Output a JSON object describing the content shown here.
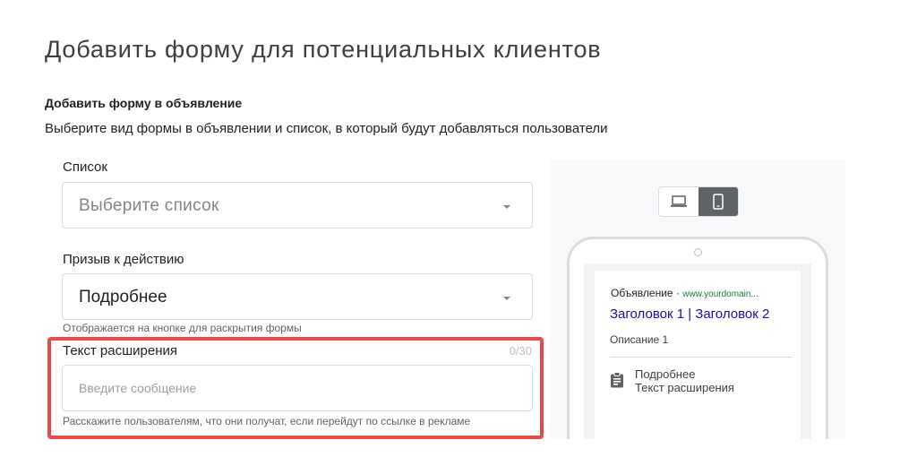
{
  "page": {
    "title": "Добавить форму для потенциальных клиентов"
  },
  "section": {
    "title": "Добавить форму в объявление",
    "description": "Выберите вид формы в объявлении и список, в который будут добавляться пользователи"
  },
  "list_field": {
    "label": "Список",
    "placeholder": "Выберите список"
  },
  "cta_field": {
    "label": "Призыв к действию",
    "value": "Подробнее",
    "helper": "Отображается на кнопке для раскрытия формы"
  },
  "extension_field": {
    "label": "Текст расширения",
    "counter": "0/30",
    "placeholder": "Введите сообщение",
    "helper": "Расскажите пользователям, что они получат, если перейдут по ссылке в рекламе"
  },
  "highlight": {
    "color": "#e94b4b"
  },
  "preview": {
    "device_toggle": {
      "options": [
        "desktop-icon",
        "mobile-icon"
      ],
      "selected": "mobile"
    },
    "ad": {
      "label": "Объявление",
      "separator": " · ",
      "domain": "www.yourdomain...",
      "headline": "Заголовок 1 | Заголовок 2",
      "description": "Описание 1",
      "extension_icon": "clipboard-icon",
      "extension_title": "Подробнее",
      "extension_text": "Текст расширения"
    }
  },
  "colors": {
    "headline_link": "#1a0dab",
    "domain": "#188038",
    "toggle_active": "#5f6368"
  }
}
